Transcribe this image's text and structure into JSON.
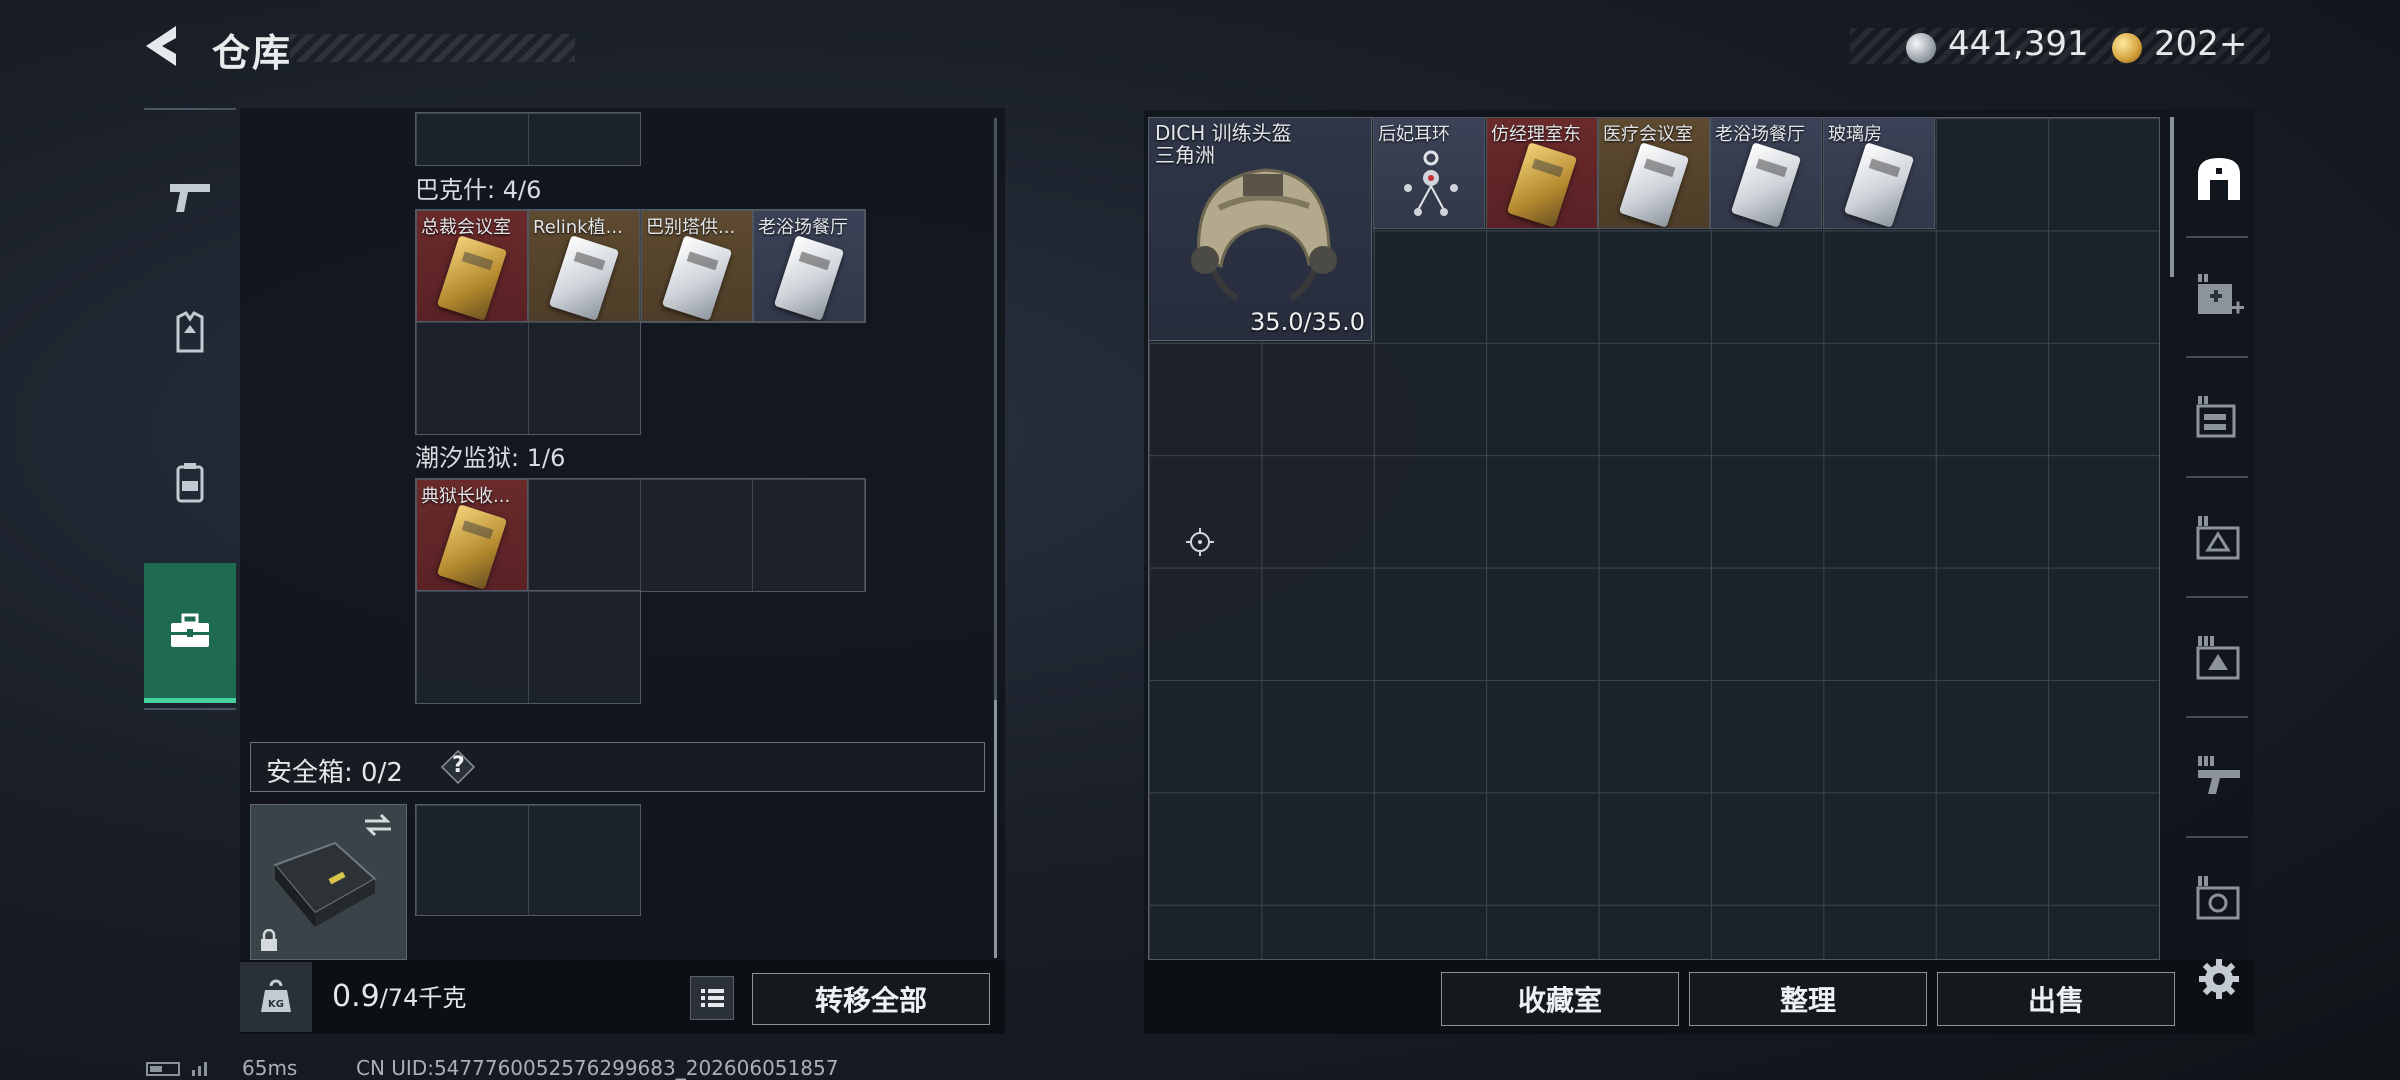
{
  "header": {
    "title": "仓库",
    "currency_silver": "441,391",
    "currency_gold": "202",
    "currency_gold_add": "+"
  },
  "left_panel": {
    "sections": [
      {
        "label": "巴克什: 4/6",
        "items": [
          {
            "name": "总裁会议室",
            "rarity": "red",
            "card": "gold"
          },
          {
            "name": "Relink植...",
            "rarity": "gold",
            "card": "silver"
          },
          {
            "name": "巴别塔供...",
            "rarity": "gold",
            "card": "silver"
          },
          {
            "name": "老浴场餐厅",
            "rarity": "blue",
            "card": "silver"
          }
        ]
      },
      {
        "label": "潮汐监狱: 1/6",
        "items": [
          {
            "name": "典狱长收...",
            "rarity": "red",
            "card": "gold"
          }
        ]
      }
    ],
    "safebox": {
      "label": "安全箱: 0/2",
      "help": "?"
    },
    "weight": {
      "current": "0.9",
      "max": "/74千克"
    },
    "transfer_all": "转移全部"
  },
  "right_panel": {
    "helmet": {
      "name_line1": "DICH 训练头盔",
      "name_line2": "三角洲",
      "durability": "35.0/35.0"
    },
    "items": [
      {
        "name": "后妃耳环",
        "rarity": "blue",
        "kind": "earring"
      },
      {
        "name": "仿经理室东",
        "rarity": "red",
        "card": "gold"
      },
      {
        "name": "医疗会议室",
        "rarity": "gold",
        "card": "silver"
      },
      {
        "name": "老浴场餐厅",
        "rarity": "blue",
        "card": "silver"
      },
      {
        "name": "玻璃房",
        "rarity": "blue",
        "card": "silver"
      }
    ],
    "buttons": {
      "collection": "收藏室",
      "organize": "整理",
      "sell": "出售"
    }
  },
  "status_bar": {
    "ping": "65ms",
    "uid": "CN UID:5477760052576299683_202606051857"
  },
  "colors": {
    "accent": "#47d19c",
    "rare_red": "#6a2a2a",
    "rare_gold": "#5e4a30",
    "rare_blue": "#3b4257"
  }
}
